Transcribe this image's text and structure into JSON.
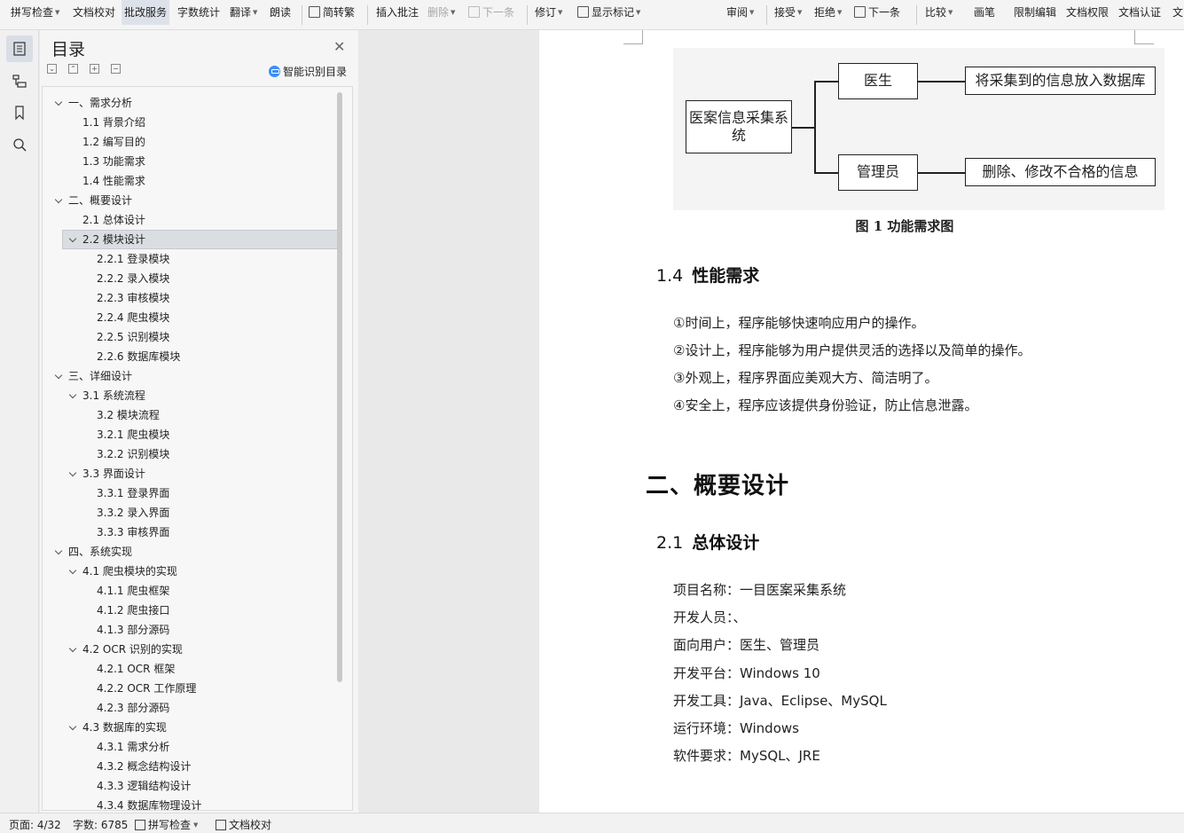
{
  "toolbar": {
    "items": [
      {
        "label": "拼写检查",
        "dropdown": true,
        "disabled": false,
        "active": false
      },
      {
        "label": "文档校对",
        "dropdown": false,
        "disabled": false,
        "active": false
      },
      {
        "label": "批改服务",
        "dropdown": false,
        "disabled": false,
        "active": true
      },
      {
        "label": "字数统计",
        "dropdown": false,
        "disabled": false,
        "active": false
      },
      {
        "label": "翻译",
        "dropdown": true,
        "disabled": false,
        "active": false
      },
      {
        "label": "朗读",
        "dropdown": false,
        "disabled": false,
        "active": false
      },
      {
        "label": "简转繁",
        "dropdown": false,
        "disabled": false,
        "active": false,
        "icon": "convert-icon"
      },
      {
        "label": "插入批注",
        "dropdown": false,
        "disabled": false,
        "active": false
      },
      {
        "label": "删除",
        "dropdown": true,
        "disabled": true,
        "active": false
      },
      {
        "label": "下一条",
        "dropdown": false,
        "disabled": true,
        "active": false,
        "icon": "next-comment-icon"
      },
      {
        "label": "修订",
        "dropdown": true,
        "disabled": false,
        "active": false
      },
      {
        "label": "显示标记",
        "dropdown": true,
        "disabled": false,
        "active": false,
        "icon": "markup-icon"
      },
      {
        "label": "审阅",
        "dropdown": true,
        "disabled": false,
        "active": false
      },
      {
        "label": "接受",
        "dropdown": true,
        "disabled": false,
        "active": false
      },
      {
        "label": "拒绝",
        "dropdown": true,
        "disabled": false,
        "active": false
      },
      {
        "label": "下一条",
        "dropdown": false,
        "disabled": false,
        "active": false,
        "icon": "next-change-icon"
      },
      {
        "label": "比较",
        "dropdown": true,
        "disabled": false,
        "active": false
      },
      {
        "label": "画笔",
        "dropdown": false,
        "disabled": false,
        "active": false
      },
      {
        "label": "限制编辑",
        "dropdown": false,
        "disabled": false,
        "active": false
      },
      {
        "label": "文档权限",
        "dropdown": false,
        "disabled": false,
        "active": false
      },
      {
        "label": "文档认证",
        "dropdown": false,
        "disabled": false,
        "active": false
      },
      {
        "label": "文",
        "dropdown": false,
        "disabled": false,
        "active": false
      }
    ]
  },
  "rail": {
    "buttons": [
      "toc-icon",
      "navigation-icon",
      "bookmark-icon",
      "search-icon"
    ]
  },
  "toc": {
    "title": "目录",
    "smart_label": "智能识别目录",
    "tools": [
      "expand-all-icon",
      "collapse-all-icon",
      "add-heading-icon",
      "remove-heading-icon"
    ],
    "items": [
      {
        "label": "一、需求分析",
        "level": 1,
        "expanded": true,
        "selected": false
      },
      {
        "label": "1.1  背景介绍",
        "level": 2,
        "expanded": null,
        "selected": false
      },
      {
        "label": "1.2  编写目的",
        "level": 2,
        "expanded": null,
        "selected": false
      },
      {
        "label": "1.3  功能需求",
        "level": 2,
        "expanded": null,
        "selected": false
      },
      {
        "label": "1.4  性能需求",
        "level": 2,
        "expanded": null,
        "selected": false
      },
      {
        "label": "二、概要设计",
        "level": 1,
        "expanded": true,
        "selected": false
      },
      {
        "label": "2.1  总体设计",
        "level": 2,
        "expanded": null,
        "selected": false
      },
      {
        "label": "2.2  模块设计",
        "level": 2,
        "expanded": true,
        "selected": true
      },
      {
        "label": "2.2.1  登录模块",
        "level": 3,
        "expanded": null,
        "selected": false
      },
      {
        "label": "2.2.2  录入模块",
        "level": 3,
        "expanded": null,
        "selected": false
      },
      {
        "label": "2.2.3  审核模块",
        "level": 3,
        "expanded": null,
        "selected": false
      },
      {
        "label": "2.2.4  爬虫模块",
        "level": 3,
        "expanded": null,
        "selected": false
      },
      {
        "label": "2.2.5  识别模块",
        "level": 3,
        "expanded": null,
        "selected": false
      },
      {
        "label": "2.2.6  数据库模块",
        "level": 3,
        "expanded": null,
        "selected": false
      },
      {
        "label": "三、详细设计",
        "level": 1,
        "expanded": true,
        "selected": false
      },
      {
        "label": "3.1  系统流程",
        "level": 2,
        "expanded": true,
        "selected": false
      },
      {
        "label": "3.2  模块流程",
        "level": 3,
        "expanded": null,
        "selected": false
      },
      {
        "label": "3.2.1  爬虫模块",
        "level": 3,
        "expanded": null,
        "selected": false
      },
      {
        "label": "3.2.2  识别模块",
        "level": 3,
        "expanded": null,
        "selected": false
      },
      {
        "label": "3.3  界面设计",
        "level": 2,
        "expanded": true,
        "selected": false
      },
      {
        "label": "3.3.1  登录界面",
        "level": 3,
        "expanded": null,
        "selected": false
      },
      {
        "label": "3.3.2  录入界面",
        "level": 3,
        "expanded": null,
        "selected": false
      },
      {
        "label": "3.3.3  审核界面",
        "level": 3,
        "expanded": null,
        "selected": false
      },
      {
        "label": "四、系统实现",
        "level": 1,
        "expanded": true,
        "selected": false
      },
      {
        "label": "4.1  爬虫模块的实现",
        "level": 2,
        "expanded": true,
        "selected": false
      },
      {
        "label": "4.1.1  爬虫框架",
        "level": 3,
        "expanded": null,
        "selected": false
      },
      {
        "label": "4.1.2  爬虫接口",
        "level": 3,
        "expanded": null,
        "selected": false
      },
      {
        "label": "4.1.3  部分源码",
        "level": 3,
        "expanded": null,
        "selected": false
      },
      {
        "label": "4.2 OCR 识别的实现",
        "level": 2,
        "expanded": true,
        "selected": false
      },
      {
        "label": "4.2.1 OCR 框架",
        "level": 3,
        "expanded": null,
        "selected": false
      },
      {
        "label": "4.2.2 OCR 工作原理",
        "level": 3,
        "expanded": null,
        "selected": false
      },
      {
        "label": "4.2.3  部分源码",
        "level": 3,
        "expanded": null,
        "selected": false
      },
      {
        "label": "4.3  数据库的实现",
        "level": 2,
        "expanded": true,
        "selected": false
      },
      {
        "label": "4.3.1  需求分析",
        "level": 3,
        "expanded": null,
        "selected": false
      },
      {
        "label": "4.3.2 概念结构设计",
        "level": 3,
        "expanded": null,
        "selected": false
      },
      {
        "label": "4.3.3 逻辑结构设计",
        "level": 3,
        "expanded": null,
        "selected": false
      },
      {
        "label": "4.3.4 数据库物理设计",
        "level": 3,
        "expanded": null,
        "selected": false
      }
    ]
  },
  "document": {
    "diagram": {
      "root": "医案信息采集系统",
      "branch_top": "医生",
      "branch_bottom": "管理员",
      "leaf_top": "将采集到的信息放入数据库",
      "leaf_bottom": "删除、修改不合格的信息"
    },
    "figure_caption": "图 1  功能需求图",
    "section_1_4": {
      "number": "1.4",
      "title": "性能需求",
      "items": [
        "①时间上，程序能够快速响应用户的操作。",
        "②设计上，程序能够为用户提供灵活的选择以及简单的操作。",
        "③外观上，程序界面应美观大方、简洁明了。",
        "④安全上，程序应该提供身份验证，防止信息泄露。"
      ]
    },
    "chapter_2_title": "二、概要设计",
    "section_2_1": {
      "number": "2.1",
      "title": "总体设计",
      "lines": [
        "项目名称：一目医案采集系统",
        "开发人员：、",
        "面向用户：医生、管理员",
        "开发平台：Windows 10",
        "开发工具：Java、Eclipse、MySQL",
        "运行环境：Windows",
        "软件要求：MySQL、JRE"
      ]
    }
  },
  "statusbar": {
    "page": "页面: 4/32",
    "words": "字数: 6785",
    "spellcheck": "拼写检查",
    "proofread": "文档校对"
  },
  "colors": {
    "toolbar_bg": "#f4f4f4",
    "panel_bg": "#f5f5f5",
    "selection": "#dadde2",
    "smart_toc_icon": "#3a8ef6",
    "page": "#ffffff"
  }
}
